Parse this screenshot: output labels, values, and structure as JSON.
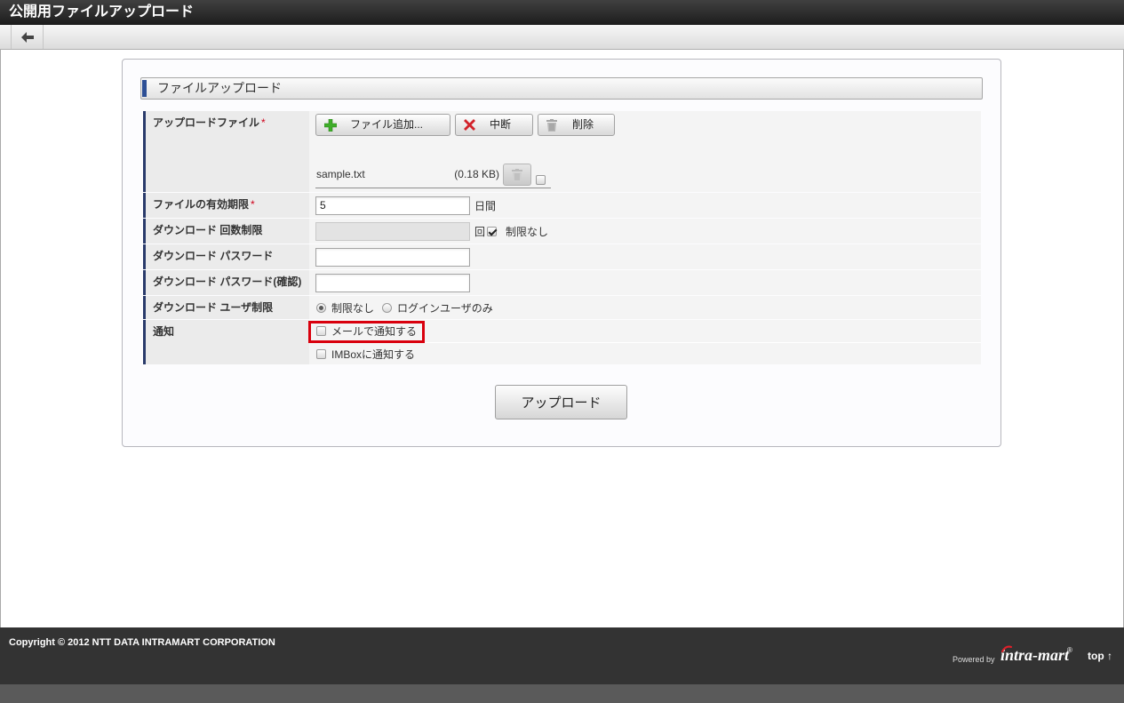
{
  "window": {
    "title": "公開用ファイルアップロード"
  },
  "toolbar": {
    "back_icon": "arrow-left-icon"
  },
  "section": {
    "title": "ファイルアップロード"
  },
  "form": {
    "upload_file": {
      "label": "アップロードファイル",
      "required_mark": "*",
      "add_button": {
        "label": "ファイル追加...",
        "icon": "plus-icon"
      },
      "stop_button": {
        "label": "中断",
        "icon": "x-icon"
      },
      "delete_button": {
        "label": "削除",
        "icon": "trash-icon"
      },
      "files": [
        {
          "name": "sample.txt",
          "size": "(0.18 KB)",
          "delete_icon": "trash-icon",
          "selected": false
        }
      ]
    },
    "expiry": {
      "label": "ファイルの有効期限",
      "required_mark": "*",
      "value": "5",
      "unit": "日間"
    },
    "download_limit": {
      "label": "ダウンロード 回数制限",
      "value": "",
      "unit": "回",
      "unlimited": {
        "label": "制限なし",
        "checked": true
      }
    },
    "password": {
      "label": "ダウンロード パスワード",
      "value": ""
    },
    "password_confirm": {
      "label": "ダウンロード パスワード(確認)",
      "value": ""
    },
    "user_restriction": {
      "label": "ダウンロード ユーザ制限",
      "options": [
        {
          "label": "制限なし",
          "checked": true
        },
        {
          "label": "ログインユーザのみ",
          "checked": false
        }
      ]
    },
    "notification": {
      "label": "通知",
      "options": [
        {
          "label": "メールで通知する",
          "checked": false
        },
        {
          "label": "IMBoxに通知する",
          "checked": false
        }
      ]
    }
  },
  "submit": {
    "label": "アップロード"
  },
  "footer": {
    "copyright": "Copyright © 2012 NTT DATA INTRAMART CORPORATION",
    "powered_by": "Powered by",
    "brand": "intra-mart",
    "brand_mark": "®",
    "top_link": "top ↑"
  },
  "colors": {
    "title_bar": "#2b2b2b",
    "label_accent": "#2a3b6b",
    "required": "#d0021b",
    "highlight": "#d9000d",
    "footer": "#333333"
  }
}
